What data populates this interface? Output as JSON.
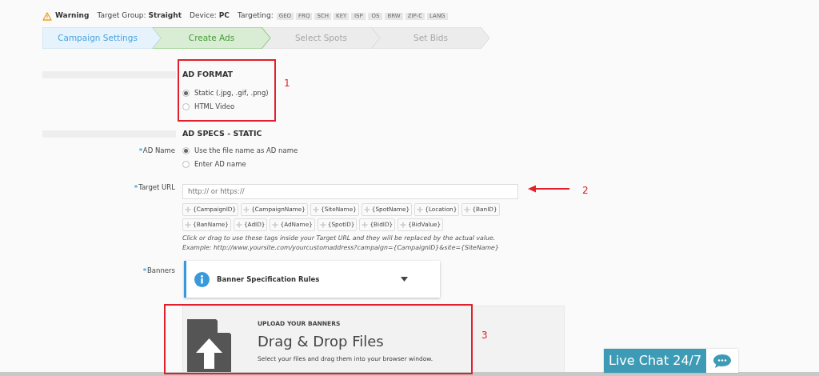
{
  "info_bar": {
    "warning": "Warning",
    "target_group_label": "Target Group:",
    "target_group": "Straight",
    "device_label": "Device:",
    "device": "PC",
    "targeting_label": "Targeting:",
    "targeting_tags": [
      "GEO",
      "FRQ",
      "SCH",
      "KEY",
      "ISP",
      "OS",
      "BRW",
      "ZIP-C",
      "LANG"
    ]
  },
  "steps": [
    {
      "label": "Campaign Settings",
      "completed": true,
      "selected": false
    },
    {
      "label": "Create Ads",
      "completed": false,
      "selected": true
    },
    {
      "label": "Select Spots",
      "completed": false,
      "selected": false
    },
    {
      "label": "Set Bids",
      "completed": false,
      "selected": false
    }
  ],
  "ad_format": {
    "heading": "AD FORMAT",
    "options": [
      {
        "label": "Static (.jpg, .gif, .png)",
        "selected": true
      },
      {
        "label": "HTML Video",
        "selected": false
      }
    ]
  },
  "ad_specs": {
    "heading": "AD SPECS - STATIC",
    "ad_name": {
      "label": "AD Name",
      "options": [
        {
          "label": "Use the file name as AD name",
          "selected": true
        },
        {
          "label": "Enter AD name",
          "selected": false
        }
      ]
    },
    "target_url": {
      "label": "Target URL",
      "placeholder": "http:// or https://",
      "tags": [
        "{CampaignID}",
        "{CampaignName}",
        "{SiteName}",
        "{SpotName}",
        "{Location}",
        "{BanID}",
        "{BanName}",
        "{AdID}",
        "{AdName}",
        "{SpotID}",
        "{BidID}",
        "{BidValue}"
      ],
      "help": [
        "Click or drag to use these tags inside your Target URL and they will be replaced by the actual value.",
        "Example: http://www.yoursite.com/yourcustomaddress?campaign={CampaignID}&site={SiteName}"
      ]
    },
    "banners": {
      "label": "Banners",
      "rules_title": "Banner Specification Rules",
      "upload_kicker": "UPLOAD YOUR BANNERS",
      "upload_title": "Drag & Drop Files",
      "upload_hint": "Select your files and drag them into your browser window."
    }
  },
  "annotations": [
    "1",
    "2",
    "3"
  ],
  "live_chat": {
    "label": "Live Chat 24/7"
  }
}
